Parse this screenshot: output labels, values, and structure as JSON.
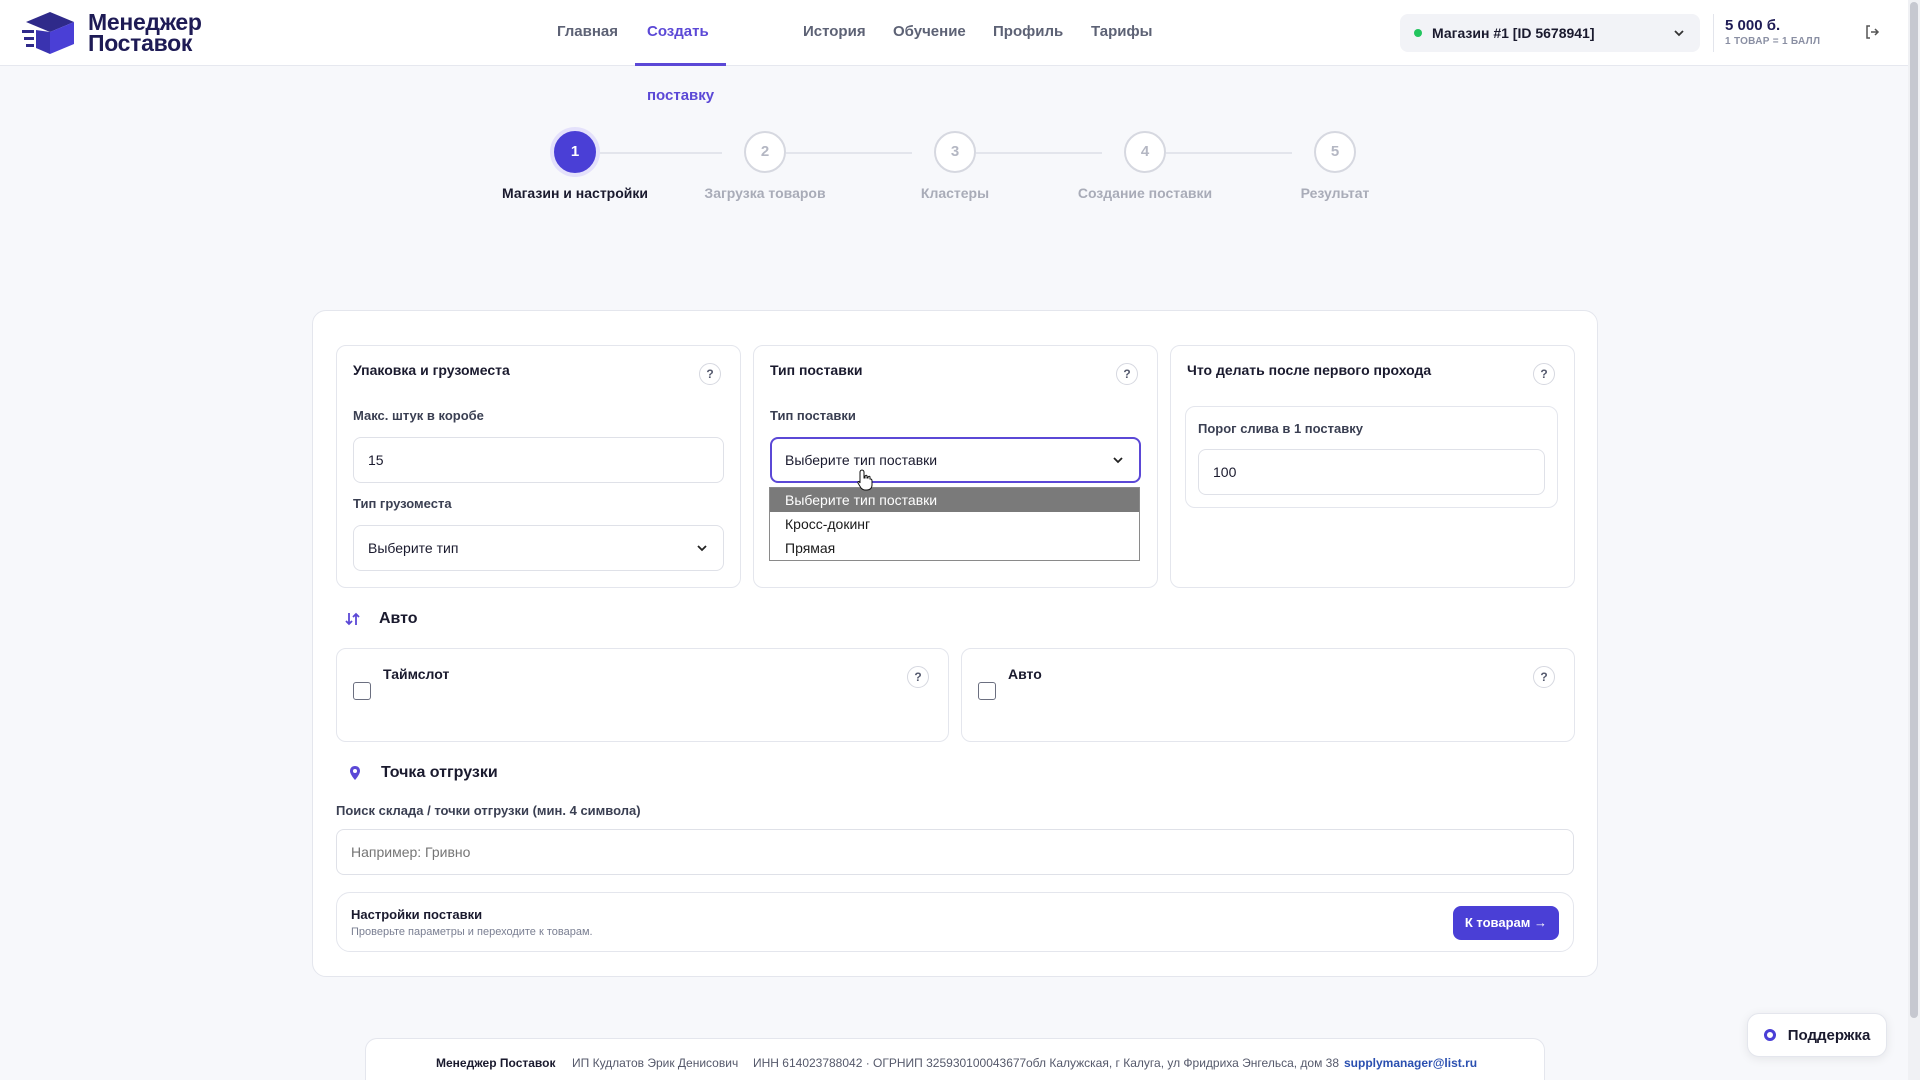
{
  "app": {
    "logo_line1": "Менеджер",
    "logo_line2": "Поставок"
  },
  "nav": {
    "items": [
      "Главная",
      "Создать поставку",
      "История",
      "Обучение",
      "Профиль",
      "Тарифы"
    ],
    "active": "Создать поставку"
  },
  "store": {
    "label": "Магазин #1 [ID 5678941]",
    "status_color": "#22c55e"
  },
  "balance": {
    "amount": "5 000 б.",
    "rate": "1 ТОВАР = 1 БАЛЛ"
  },
  "stepper": {
    "current": 1,
    "steps": [
      {
        "num": "1",
        "label": "Магазин и настройки"
      },
      {
        "num": "2",
        "label": "Загрузка товаров"
      },
      {
        "num": "3",
        "label": "Кластеры"
      },
      {
        "num": "4",
        "label": "Создание поставки"
      },
      {
        "num": "5",
        "label": "Результат"
      }
    ]
  },
  "packaging": {
    "title": "Упаковка и грузоместа",
    "max_label": "Макс. штук в коробе",
    "max_value": "15",
    "cargo_label": "Тип грузоместа",
    "cargo_value": "Выберите тип"
  },
  "supply_type": {
    "title": "Тип поставки",
    "field_label": "Тип поставки",
    "value": "Выберите тип поставки",
    "options": [
      "Выберите тип поставки",
      "Кросс-докинг",
      "Прямая"
    ],
    "highlighted_index": 0
  },
  "after_pass": {
    "title": "Что делать после первого прохода",
    "threshold_label": "Порог слива в 1 поставку",
    "threshold_value": "100"
  },
  "auto_section": {
    "title": "Авто",
    "timeslot_label": "Таймслот",
    "auto_label": "Авто"
  },
  "shipment": {
    "title": "Точка отгрузки",
    "search_label": "Поиск склада / точки отгрузки (мин. 4 символа)",
    "search_placeholder": "Например: Гривно"
  },
  "settings_bar": {
    "title": "Настройки поставки",
    "subtitle": "Проверьте параметры и переходите к товарам.",
    "button": "К товарам →"
  },
  "help_symbol": "?",
  "support": {
    "label": "Поддержка"
  },
  "footer": {
    "brand": "Менеджер Поставок",
    "owner": "ИП Кудлатов Эрик Денисович",
    "ids": "ИНН 614023788042 · ОГРНИП 325930100043677",
    "address": "обл Калужская, г Калуга, ул Фридриха Энгельса, дом 38",
    "email": "supplymanager@list.ru"
  },
  "colors": {
    "accent": "#4a3fd6",
    "link": "#2a4fb0"
  }
}
